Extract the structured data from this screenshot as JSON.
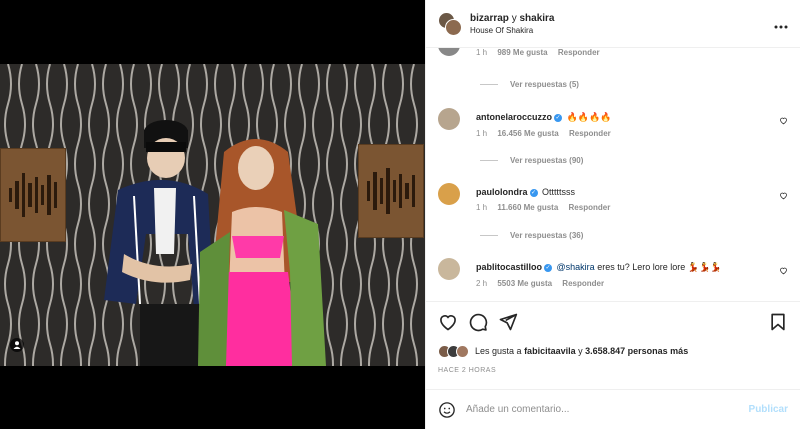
{
  "header": {
    "user1": "bizarrap",
    "connector": "y",
    "user2": "shakira",
    "location": "House Of Shakira",
    "more_icon": "more-horizontal-icon"
  },
  "comments_partial": {
    "meta_time": "1 h",
    "meta_likes": "989 Me gusta",
    "meta_reply": "Responder",
    "view_replies": "Ver respuestas (5)"
  },
  "comments": [
    {
      "user": "antonelaroccuzzo",
      "verified": true,
      "text": "🔥🔥🔥🔥",
      "time": "1 h",
      "likes": "16.456 Me gusta",
      "reply": "Responder",
      "view_replies": "Ver respuestas (90)",
      "avatar_color": "#b7a58e"
    },
    {
      "user": "paulolondra",
      "verified": true,
      "text": "Otttttsss",
      "time": "1 h",
      "likes": "11.660 Me gusta",
      "reply": "Responder",
      "view_replies": "Ver respuestas (36)",
      "avatar_color": "#d9a04a"
    },
    {
      "user": "pablitocastilloo",
      "verified": true,
      "mention": "@shakira",
      "text": "eres tu? Lero lore lore 💃💃💃",
      "time": "2 h",
      "likes": "5503 Me gusta",
      "reply": "Responder",
      "avatar_color": "#c9b79c"
    }
  ],
  "likes": {
    "prefix": "Les gusta a",
    "user": "fabicitaavila",
    "middle": "y",
    "count": "3.658.847 personas más"
  },
  "timestamp": "HACE 2 HORAS",
  "composer": {
    "placeholder": "Añade un comentario...",
    "publish": "Publicar"
  },
  "colors": {
    "verified": "#3897f0",
    "publish_disabled": "#b2dffc",
    "muted": "#8e8e8e"
  }
}
